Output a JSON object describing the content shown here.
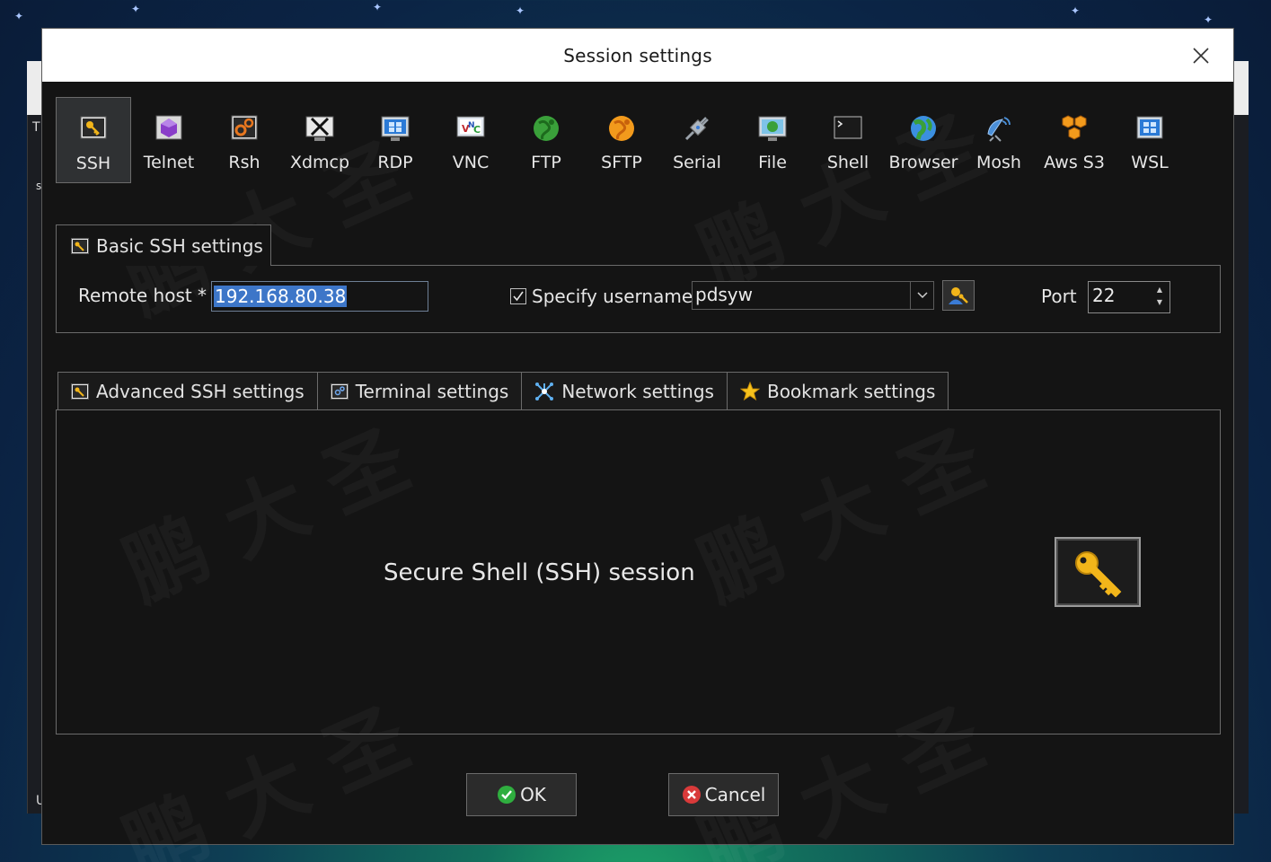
{
  "background": {
    "app_letters": [
      "T",
      "s",
      "U"
    ]
  },
  "dialog": {
    "title": "Session settings",
    "protocols": [
      {
        "id": "ssh",
        "label": "SSH",
        "icon": "key-icon",
        "active": true
      },
      {
        "id": "telnet",
        "label": "Telnet",
        "icon": "purple-gem-icon",
        "active": false
      },
      {
        "id": "rsh",
        "label": "Rsh",
        "icon": "gears-icon",
        "active": false
      },
      {
        "id": "xdmcp",
        "label": "Xdmcp",
        "icon": "x-display-icon",
        "active": false
      },
      {
        "id": "rdp",
        "label": "RDP",
        "icon": "windows-monitor-icon",
        "active": false
      },
      {
        "id": "vnc",
        "label": "VNC",
        "icon": "vnc-icon",
        "active": false
      },
      {
        "id": "ftp",
        "label": "FTP",
        "icon": "green-globe-icon",
        "active": false
      },
      {
        "id": "sftp",
        "label": "SFTP",
        "icon": "orange-globe-icon",
        "active": false
      },
      {
        "id": "serial",
        "label": "Serial",
        "icon": "satellite-plug-icon",
        "active": false
      },
      {
        "id": "file",
        "label": "File",
        "icon": "file-monitor-icon",
        "active": false
      },
      {
        "id": "shell",
        "label": "Shell",
        "icon": "terminal-icon",
        "active": false
      },
      {
        "id": "browser",
        "label": "Browser",
        "icon": "earth-globe-icon",
        "active": false
      },
      {
        "id": "mosh",
        "label": "Mosh",
        "icon": "satellite-dish-icon",
        "active": false
      },
      {
        "id": "awss3",
        "label": "Aws S3",
        "icon": "cubes-icon",
        "active": false
      },
      {
        "id": "wsl",
        "label": "WSL",
        "icon": "windows-icon",
        "active": false
      }
    ],
    "basic": {
      "tab_label": "Basic SSH settings",
      "remote_host_label": "Remote host *",
      "remote_host_value": "192.168.80.38",
      "specify_username_label": "Specify username",
      "specify_username_checked": true,
      "username_value": "pdsyw",
      "port_label": "Port",
      "port_value": "22"
    },
    "advanced_tabs": [
      {
        "label": "Advanced SSH settings",
        "icon": "key-small-icon"
      },
      {
        "label": "Terminal settings",
        "icon": "terminal-settings-icon"
      },
      {
        "label": "Network settings",
        "icon": "network-icon"
      },
      {
        "label": "Bookmark settings",
        "icon": "star-icon"
      }
    ],
    "session_description": "Secure Shell (SSH) session",
    "ok_label": "OK",
    "cancel_label": "Cancel"
  },
  "colors": {
    "selection": "#3d76c8",
    "key_gold": "#f2b51a",
    "ok_green": "#2fae3f",
    "cancel_red": "#d93a3a"
  }
}
